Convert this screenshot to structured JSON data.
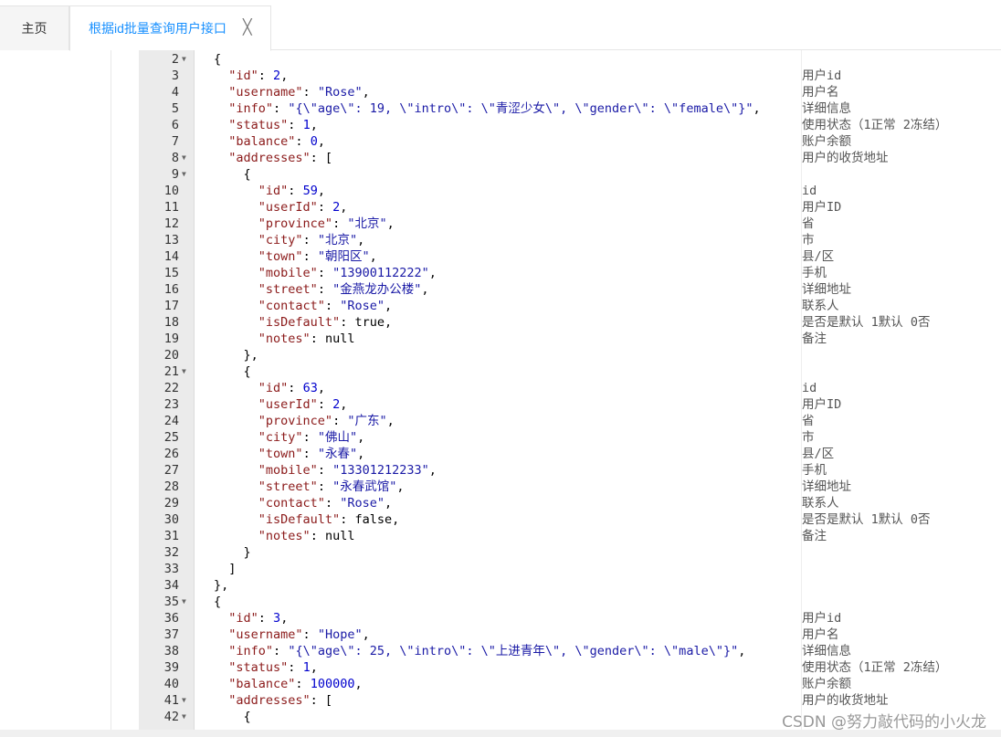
{
  "tabs": {
    "home_label": "主页",
    "active_label": "根据id批量查询用户接口",
    "close_glyph": "╳"
  },
  "watermark": "CSDN @努力敲代码的小火龙",
  "lines": [
    {
      "n": "2",
      "fold": true,
      "code": "{",
      "comment": ""
    },
    {
      "n": "3",
      "fold": false,
      "code": "  \"id\": 2,",
      "comment": "用户id"
    },
    {
      "n": "4",
      "fold": false,
      "code": "  \"username\": \"Rose\",",
      "comment": "用户名"
    },
    {
      "n": "5",
      "fold": false,
      "code": "  \"info\": \"{\\\"age\\\": 19, \\\"intro\\\": \\\"青涩少女\\\", \\\"gender\\\": \\\"female\\\"}\",",
      "comment": "详细信息"
    },
    {
      "n": "6",
      "fold": false,
      "code": "  \"status\": 1,",
      "comment": "使用状态（1正常 2冻结）"
    },
    {
      "n": "7",
      "fold": false,
      "code": "  \"balance\": 0,",
      "comment": "账户余额"
    },
    {
      "n": "8",
      "fold": true,
      "code": "  \"addresses\": [",
      "comment": "用户的收货地址"
    },
    {
      "n": "9",
      "fold": true,
      "code": "    {",
      "comment": ""
    },
    {
      "n": "10",
      "fold": false,
      "code": "      \"id\": 59,",
      "comment": "id"
    },
    {
      "n": "11",
      "fold": false,
      "code": "      \"userId\": 2,",
      "comment": "用户ID"
    },
    {
      "n": "12",
      "fold": false,
      "code": "      \"province\": \"北京\",",
      "comment": "省"
    },
    {
      "n": "13",
      "fold": false,
      "code": "      \"city\": \"北京\",",
      "comment": "市"
    },
    {
      "n": "14",
      "fold": false,
      "code": "      \"town\": \"朝阳区\",",
      "comment": "县/区"
    },
    {
      "n": "15",
      "fold": false,
      "code": "      \"mobile\": \"13900112222\",",
      "comment": "手机"
    },
    {
      "n": "16",
      "fold": false,
      "code": "      \"street\": \"金燕龙办公楼\",",
      "comment": "详细地址"
    },
    {
      "n": "17",
      "fold": false,
      "code": "      \"contact\": \"Rose\",",
      "comment": "联系人"
    },
    {
      "n": "18",
      "fold": false,
      "code": "      \"isDefault\": true,",
      "comment": "是否是默认 1默认 0否"
    },
    {
      "n": "19",
      "fold": false,
      "code": "      \"notes\": null",
      "comment": "备注"
    },
    {
      "n": "20",
      "fold": false,
      "code": "    },",
      "comment": ""
    },
    {
      "n": "21",
      "fold": true,
      "code": "    {",
      "comment": ""
    },
    {
      "n": "22",
      "fold": false,
      "code": "      \"id\": 63,",
      "comment": "id"
    },
    {
      "n": "23",
      "fold": false,
      "code": "      \"userId\": 2,",
      "comment": "用户ID"
    },
    {
      "n": "24",
      "fold": false,
      "code": "      \"province\": \"广东\",",
      "comment": "省"
    },
    {
      "n": "25",
      "fold": false,
      "code": "      \"city\": \"佛山\",",
      "comment": "市"
    },
    {
      "n": "26",
      "fold": false,
      "code": "      \"town\": \"永春\",",
      "comment": "县/区"
    },
    {
      "n": "27",
      "fold": false,
      "code": "      \"mobile\": \"13301212233\",",
      "comment": "手机"
    },
    {
      "n": "28",
      "fold": false,
      "code": "      \"street\": \"永春武馆\",",
      "comment": "详细地址"
    },
    {
      "n": "29",
      "fold": false,
      "code": "      \"contact\": \"Rose\",",
      "comment": "联系人"
    },
    {
      "n": "30",
      "fold": false,
      "code": "      \"isDefault\": false,",
      "comment": "是否是默认 1默认 0否"
    },
    {
      "n": "31",
      "fold": false,
      "code": "      \"notes\": null",
      "comment": "备注"
    },
    {
      "n": "32",
      "fold": false,
      "code": "    }",
      "comment": ""
    },
    {
      "n": "33",
      "fold": false,
      "code": "  ]",
      "comment": ""
    },
    {
      "n": "34",
      "fold": false,
      "code": "},",
      "comment": ""
    },
    {
      "n": "35",
      "fold": true,
      "code": "{",
      "comment": ""
    },
    {
      "n": "36",
      "fold": false,
      "code": "  \"id\": 3,",
      "comment": "用户id"
    },
    {
      "n": "37",
      "fold": false,
      "code": "  \"username\": \"Hope\",",
      "comment": "用户名"
    },
    {
      "n": "38",
      "fold": false,
      "code": "  \"info\": \"{\\\"age\\\": 25, \\\"intro\\\": \\\"上进青年\\\", \\\"gender\\\": \\\"male\\\"}\",",
      "comment": "详细信息"
    },
    {
      "n": "39",
      "fold": false,
      "code": "  \"status\": 1,",
      "comment": "使用状态（1正常 2冻结）"
    },
    {
      "n": "40",
      "fold": false,
      "code": "  \"balance\": 100000,",
      "comment": "账户余额"
    },
    {
      "n": "41",
      "fold": true,
      "code": "  \"addresses\": [",
      "comment": "用户的收货地址"
    },
    {
      "n": "42",
      "fold": true,
      "code": "    {",
      "comment": ""
    }
  ]
}
